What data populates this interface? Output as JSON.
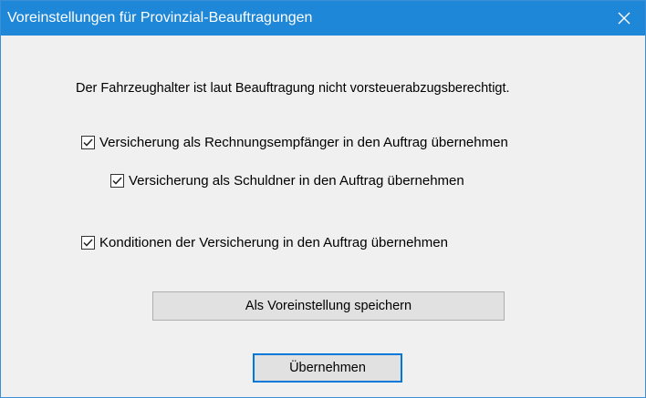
{
  "window": {
    "title": "Voreinstellungen für Provinzial-Beauftragungen",
    "close_icon": "close-icon"
  },
  "info_text": "Der Fahrzeughalter ist laut Beauftragung nicht vorsteuerabzugsberechtigt.",
  "checkboxes": [
    {
      "label": "Versicherung als Rechnungsempfänger in den Auftrag übernehmen",
      "checked": true
    },
    {
      "label": "Versicherung als Schuldner in den Auftrag übernehmen",
      "checked": true
    },
    {
      "label": "Konditionen der Versicherung in den Auftrag übernehmen",
      "checked": true
    }
  ],
  "buttons": {
    "save_default": "Als Voreinstellung speichern",
    "apply": "Übernehmen"
  },
  "colors": {
    "titlebar": "#1f87d8",
    "focus_border": "#0078d7"
  }
}
